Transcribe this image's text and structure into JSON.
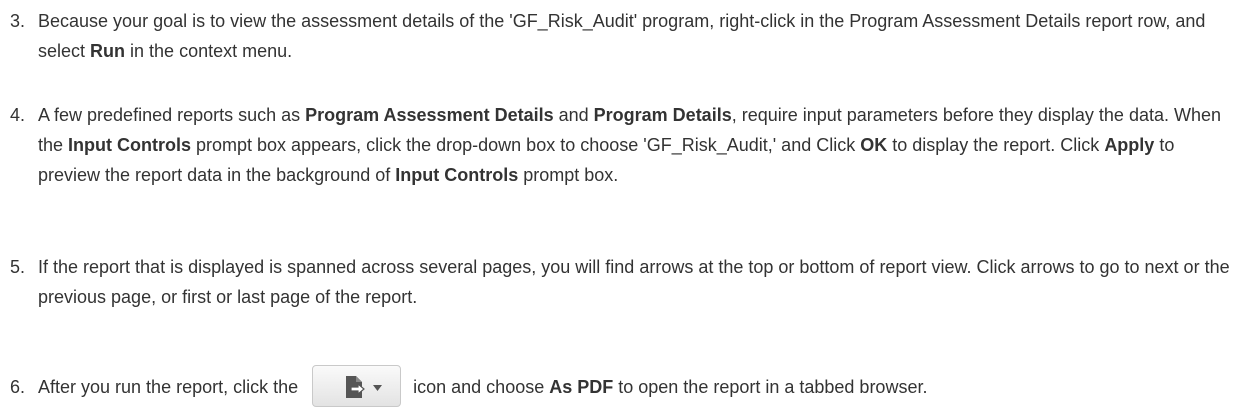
{
  "steps": [
    {
      "number": "3.",
      "parts": [
        {
          "text": "Because your goal is to view the assessment details of the 'GF_Risk_Audit' program, right-click in the Program Assessment Details report row, and select ",
          "bold": false
        },
        {
          "text": "Run",
          "bold": true
        },
        {
          "text": " in the context menu.",
          "bold": false
        }
      ]
    },
    {
      "number": "4.",
      "parts": [
        {
          "text": "A few predefined reports such as ",
          "bold": false
        },
        {
          "text": "Program Assessment Details",
          "bold": true
        },
        {
          "text": " and ",
          "bold": false
        },
        {
          "text": "Program Details",
          "bold": true
        },
        {
          "text": ", require input parameters before they display the data. When the ",
          "bold": false
        },
        {
          "text": "Input Controls",
          "bold": true
        },
        {
          "text": " prompt box appears, click the drop-down box to choose 'GF_Risk_Audit,' and Click ",
          "bold": false
        },
        {
          "text": "OK",
          "bold": true
        },
        {
          "text": " to display the report. Click ",
          "bold": false
        },
        {
          "text": "Apply",
          "bold": true
        },
        {
          "text": " to preview the report data in the background of ",
          "bold": false
        },
        {
          "text": "Input Controls",
          "bold": true
        },
        {
          "text": " prompt box.",
          "bold": false
        }
      ]
    },
    {
      "number": "5.",
      "parts": [
        {
          "text": "If the report that is displayed is spanned across several pages, you will find arrows at the top or bottom of report view. Click arrows to go to next or the previous page, or first or last page of the report.",
          "bold": false
        }
      ]
    }
  ],
  "step6": {
    "number": "6.",
    "before_icon": "After you run the report, click the",
    "icon": "export-document-icon",
    "after_icon_1": "icon and choose ",
    "bold_1": "As PDF",
    "after_icon_2": " to open the report in a tabbed browser."
  },
  "colors": {
    "text": "#333333",
    "button_border": "#c9c9c9",
    "icon": "#555555"
  }
}
